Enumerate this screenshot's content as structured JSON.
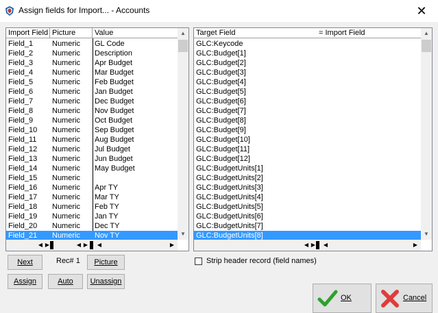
{
  "window": {
    "title": "Assign fields for Import... - Accounts",
    "close_glyph": "✕"
  },
  "left_grid": {
    "columns": [
      "Import Field",
      "Picture",
      "Value"
    ],
    "rows": [
      [
        "Field_1",
        "Numeric",
        "GL Code"
      ],
      [
        "Field_2",
        "Numeric",
        "Description"
      ],
      [
        "Field_3",
        "Numeric",
        "Apr Budget"
      ],
      [
        "Field_4",
        "Numeric",
        "Mar Budget"
      ],
      [
        "Field_5",
        "Numeric",
        "Feb Budget"
      ],
      [
        "Field_6",
        "Numeric",
        "Jan Budget"
      ],
      [
        "Field_7",
        "Numeric",
        "Dec Budget"
      ],
      [
        "Field_8",
        "Numeric",
        "Nov Budget"
      ],
      [
        "Field_9",
        "Numeric",
        "Oct Budget"
      ],
      [
        "Field_10",
        "Numeric",
        "Sep Budget"
      ],
      [
        "Field_11",
        "Numeric",
        "Aug Budget"
      ],
      [
        "Field_12",
        "Numeric",
        "Jul Budget"
      ],
      [
        "Field_13",
        "Numeric",
        "Jun Budget"
      ],
      [
        "Field_14",
        "Numeric",
        "May Budget"
      ],
      [
        "Field_15",
        "Numeric",
        ""
      ],
      [
        "Field_16",
        "Numeric",
        "Apr TY"
      ],
      [
        "Field_17",
        "Numeric",
        "Mar TY"
      ],
      [
        "Field_18",
        "Numeric",
        "Feb TY"
      ],
      [
        "Field_19",
        "Numeric",
        "Jan TY"
      ],
      [
        "Field_20",
        "Numeric",
        "Dec TY"
      ],
      [
        "Field_21",
        "Numeric",
        "Nov TY"
      ]
    ],
    "selected_index": 20
  },
  "right_grid": {
    "columns": [
      "Target Field",
      "= Import Field"
    ],
    "rows": [
      "GLC:Keycode",
      "GLC:Budget[1]",
      "GLC:Budget[2]",
      "GLC:Budget[3]",
      "GLC:Budget[4]",
      "GLC:Budget[5]",
      "GLC:Budget[6]",
      "GLC:Budget[7]",
      "GLC:Budget[8]",
      "GLC:Budget[9]",
      "GLC:Budget[10]",
      "GLC:Budget[11]",
      "GLC:Budget[12]",
      "GLC:BudgetUnits[1]",
      "GLC:BudgetUnits[2]",
      "GLC:BudgetUnits[3]",
      "GLC:BudgetUnits[4]",
      "GLC:BudgetUnits[5]",
      "GLC:BudgetUnits[6]",
      "GLC:BudgetUnits[7]",
      "GLC:BudgetUnits[8]"
    ],
    "selected_index": 20
  },
  "buttons": {
    "next": "Next",
    "picture": "Picture",
    "assign": "Assign",
    "auto": "Auto",
    "unassign": "Unassign",
    "ok": "OK",
    "cancel": "Cancel"
  },
  "record": {
    "label": "Rec# 1"
  },
  "strip_header": {
    "label": "Strip header record (field names)",
    "checked": false
  },
  "colors": {
    "selection": "#3399ff",
    "ok_icon": "#2ea02e",
    "cancel_icon": "#e03c3c"
  },
  "icons": {
    "ok": "green-check-icon",
    "cancel": "red-x-icon",
    "app": "shield-app-icon"
  }
}
